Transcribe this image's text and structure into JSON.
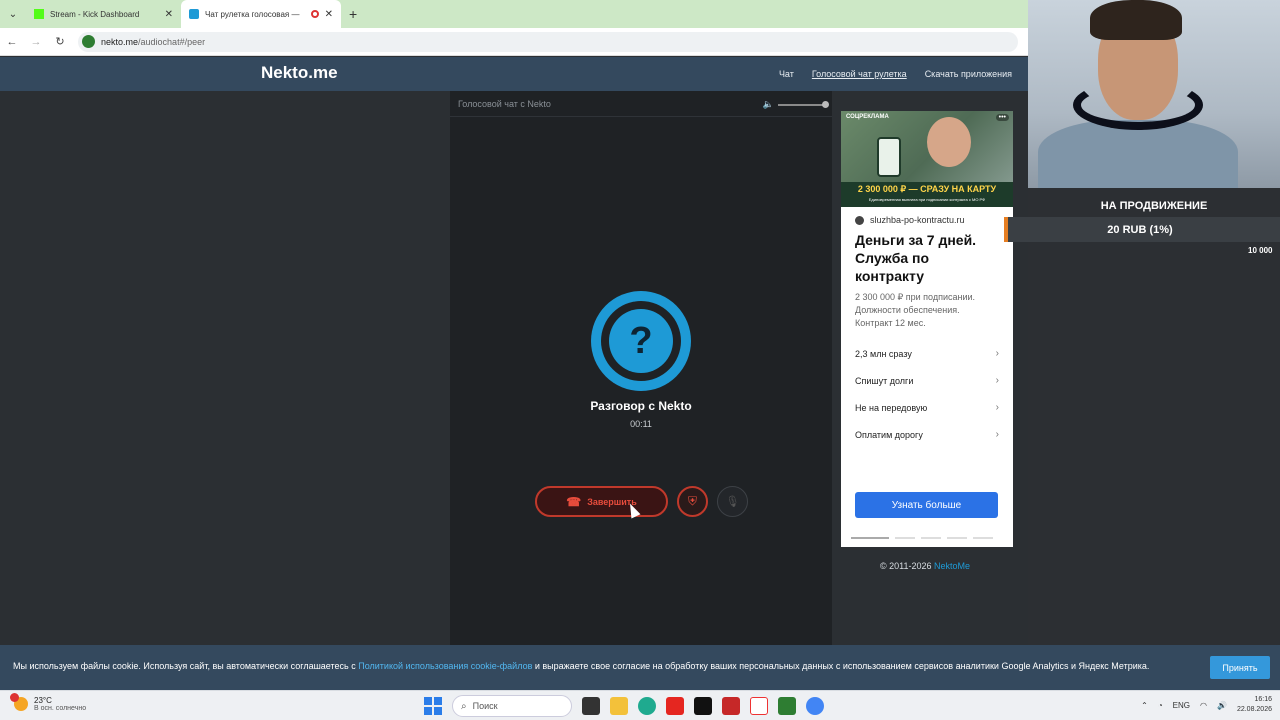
{
  "browser": {
    "tabs": [
      {
        "title": "Stream - Kick Dashboard",
        "active": false
      },
      {
        "title": "Чат рулетка голосовая — ",
        "active": true
      }
    ],
    "url_host": "nekto.me",
    "url_path": "/audiochat#/peer"
  },
  "site": {
    "logo": "Nekto.me",
    "nav": [
      "Чат",
      "Голосовой чат рулетка",
      "Скачать приложения"
    ]
  },
  "chat": {
    "header": "Голосовой чат с Nekto",
    "avatar_glyph": "?",
    "title": "Разговор с Nekto",
    "timer": "00:11",
    "end_label": "Завершить"
  },
  "ad": {
    "label": "СОЦРЕКЛАМА",
    "banner": "2 300 000 ₽ — СРАЗУ НА КАРТУ",
    "banner_sub": "Единовременная выплата при подписании контракта с МО РФ",
    "source": "sluzhba-po-kontractu.ru",
    "title": "Деньги за 7 дней. Служба по контракту",
    "description": "2 300 000 ₽ при подписании. Должности обеспечения. Контракт 12 мес.",
    "links": [
      "2,3 млн сразу",
      "Спишут долги",
      "Не на передовую",
      "Оплатим дорогу"
    ],
    "cta": "Узнать больше"
  },
  "footer": {
    "copyright": "© 2011-2026",
    "copyright_link": "NektoMe"
  },
  "cookie": {
    "text_before": "Мы используем файлы cookie. Используя сайт, вы автоматически соглашаетесь с",
    "link": "Политикой использования cookie-файлов",
    "text_after": "и выражаете свое согласие на обработку ваших персональных данных с использованием сервисов аналитики Google Analytics и Яндекс Метрика.",
    "accept": "Принять"
  },
  "stream_overlay": {
    "promo_title": "НА ПРОДВИЖЕНИЕ",
    "promo_amount": "20 RUB (1%)",
    "promo_goal": "10 000"
  },
  "taskbar": {
    "temp": "23°C",
    "weather": "В осн. солнечно",
    "search": "Поиск",
    "lang": "ENG",
    "time": "16:16",
    "date": "22.08.2026"
  },
  "colors": {
    "accent": "#1e9ad6",
    "danger": "#c0392b",
    "header_bg": "#34495e",
    "ad_cta": "#2b72e6"
  }
}
